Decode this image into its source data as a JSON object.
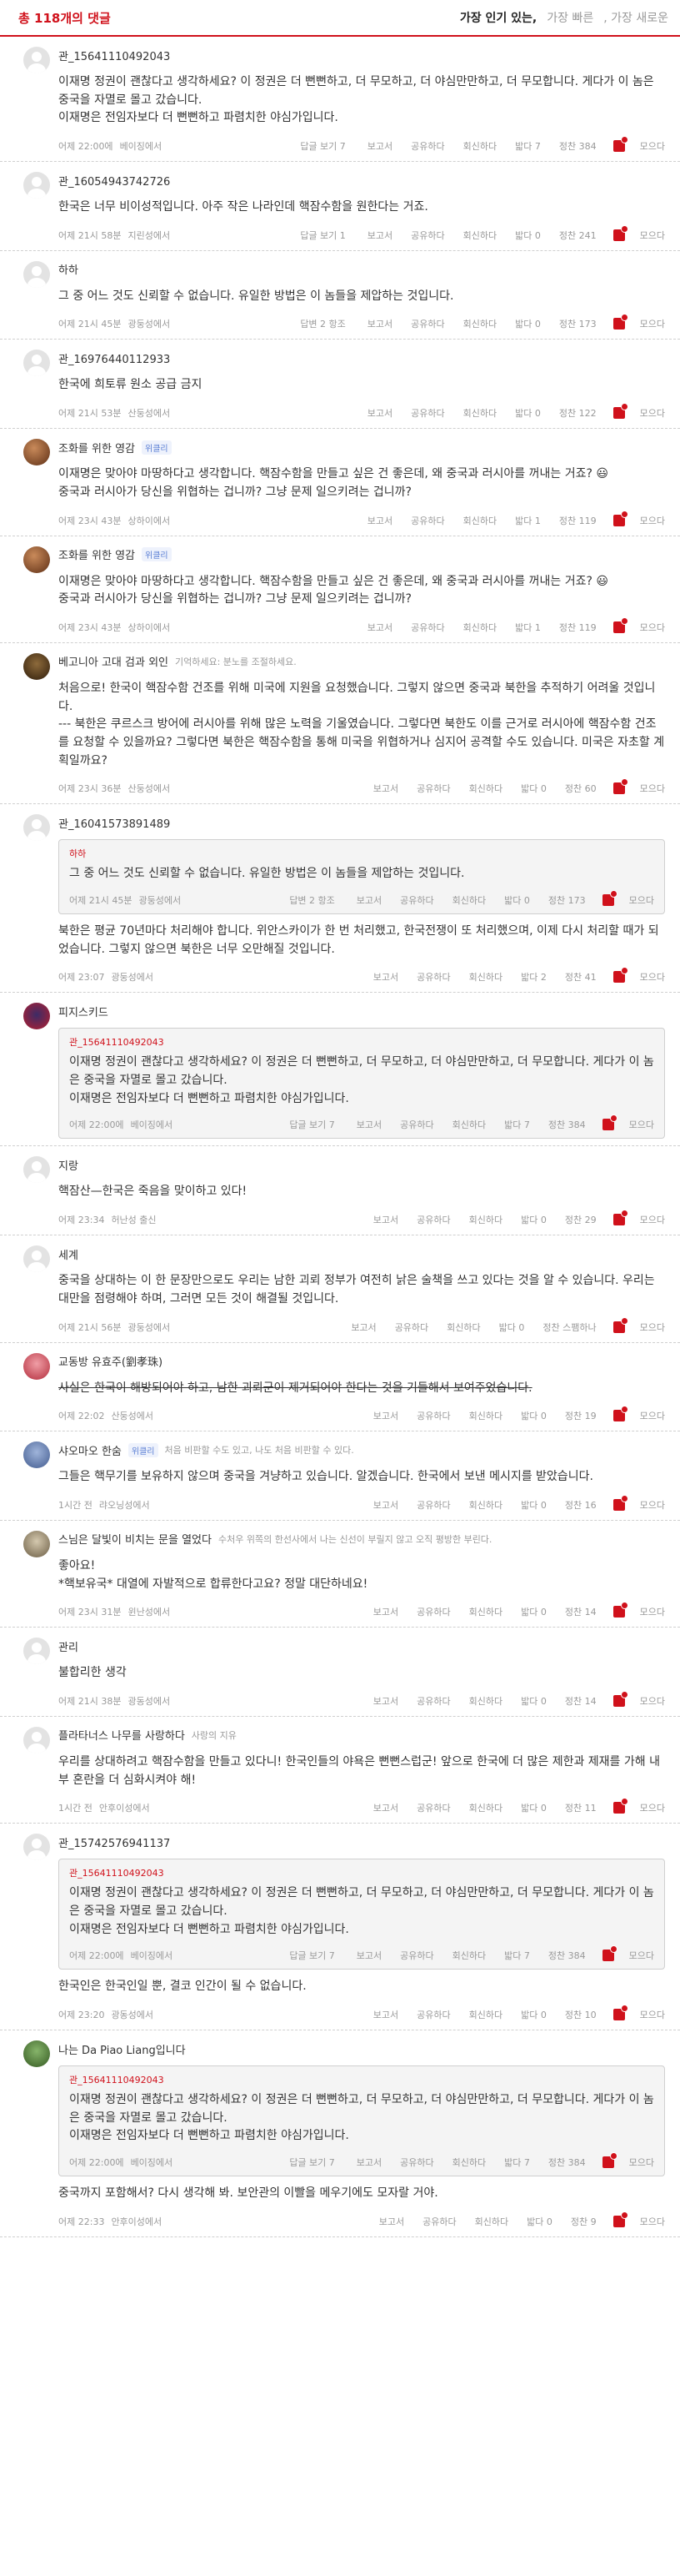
{
  "header": {
    "count_label": "총 118개의 댓글",
    "sort": {
      "popular": "가장 인기 있는,",
      "fast": "가장 빠른",
      "new": ", 가장 새로운"
    }
  },
  "labels": {
    "replies": "답글 보기",
    "report": "보고서",
    "share": "공유하다",
    "recommend": "회신하다",
    "down": "밟다",
    "up": "정찬",
    "more": "모으다"
  },
  "comments": [
    {
      "author": "관_15641110492043",
      "text": "이재명 정권이 괜찮다고 생각하세요? 이 정권은 더 뻔뻔하고, 더 무모하고, 더 야심만만하고, 더 무모합니다. 게다가 이 놈은 중국을 자멸로 몰고 갔습니다.\n이재명은 전임자보다 더 뻔뻔하고 파렴치한 야심가입니다.",
      "time": "어제 22:00에",
      "loc": "베이징에서",
      "replies": "답글 보기 7",
      "down": "밟다 7",
      "up": "정찬 384"
    },
    {
      "author": "관_16054943742726",
      "text": "한국은 너무 비이성적입니다. 아주 작은 나라인데 핵잠수함을 원한다는 거죠.",
      "time": "어제 21시 58분",
      "loc": "지린성에서",
      "replies": "답글 보기 1",
      "down": "밟다 0",
      "up": "정찬 241"
    },
    {
      "author": "하하",
      "text": "그 중 어느 것도 신뢰할 수 없습니다. 유일한 방법은 이 놈들을 제압하는 것입니다.",
      "time": "어제 21시 45분",
      "loc": "광둥성에서",
      "replies": "답변 2 항조",
      "down": "밟다 0",
      "up": "정찬 173"
    },
    {
      "author": "관_16976440112933",
      "text": "한국에 희토류 원소 공급 금지",
      "time": "어제 21시 53분",
      "loc": "산둥성에서",
      "replies": "",
      "down": "밟다 0",
      "up": "정찬 122"
    },
    {
      "author": "조화를 위한 영감",
      "badge": "위클리",
      "text": "이재명은 맞아야 마땅하다고 생각합니다. 핵잠수함을 만들고 싶은 건 좋은데, 왜 중국과 러시아를 꺼내는 거죠? 😃\n중국과 러시아가 당신을 위협하는 겁니까? 그냥 문제 일으키려는 겁니까?",
      "time": "어제 23시 43분",
      "loc": "상하이에서",
      "replies": "",
      "down": "밟다 1",
      "up": "정찬 119"
    },
    {
      "author": "조화를 위한 영감",
      "badge": "위클리",
      "text": "이재명은 맞아야 마땅하다고 생각합니다. 핵잠수함을 만들고 싶은 건 좋은데, 왜 중국과 러시아를 꺼내는 거죠? 😃\n중국과 러시아가 당신을 위협하는 겁니까? 그냥 문제 일으키려는 겁니까?",
      "time": "어제 23시 43분",
      "loc": "상하이에서",
      "replies": "",
      "down": "밟다 1",
      "up": "정찬 119"
    },
    {
      "author": "베고니아 고대 검과 외인",
      "sub": "기억하세요: 분노를 조절하세요.",
      "text": "처음으로! 한국이 핵잠수함 건조를 위해 미국에 지원을 요청했습니다. 그렇지 않으면 중국과 북한을 추적하기 어려울 것입니다.\n--- 북한은 쿠르스크 방어에 러시아를 위해 많은 노력을 기울였습니다. 그렇다면 북한도 이를 근거로 러시아에 핵잠수함 건조를 요청할 수 있을까요? 그렇다면 북한은 핵잠수함을 통해 미국을 위협하거나 심지어 공격할 수도 있습니다. 미국은 자초할 계획일까요?",
      "time": "어제 23시 36분",
      "loc": "산둥성에서",
      "replies": "",
      "down": "밟다 0",
      "up": "정찬 60"
    },
    {
      "author": "관_16041573891489",
      "quote": {
        "author": "하하",
        "text": "그 중 어느 것도 신뢰할 수 없습니다. 유일한 방법은 이 놈들을 제압하는 것입니다.",
        "time": "어제 21시 45분",
        "loc": "광둥성에서",
        "replies": "답변 2 항조",
        "down": "밟다 0",
        "up": "정찬 173"
      },
      "text": "북한은 평균 70년마다 처리해야 합니다. 위안스카이가 한 번 처리했고, 한국전쟁이 또 처리했으며, 이제 다시 처리할 때가 되었습니다. 그렇지 않으면 북한은 너무 오만해질 것입니다.",
      "time": "어제 23:07",
      "loc": "광둥성에서",
      "replies": "",
      "down": "밟다 2",
      "up": "정찬 41"
    },
    {
      "author": "피지스키드",
      "quote": {
        "author": "관_15641110492043",
        "text": "이재명 정권이 괜찮다고 생각하세요? 이 정권은 더 뻔뻔하고, 더 무모하고, 더 야심만만하고, 더 무모합니다. 게다가 이 놈은 중국을 자멸로 몰고 갔습니다.\n이재명은 전임자보다 더 뻔뻔하고 파렴치한 야심가입니다.",
        "time": "어제 22:00에",
        "loc": "베이징에서",
        "replies": "답글 보기 7",
        "down": "밟다 7",
        "up": "정찬 384"
      },
      "text": "",
      "time": "",
      "loc": "",
      "replies": "",
      "down": "",
      "up": ""
    },
    {
      "author": "지랑",
      "text": "핵잠산—한국은 죽음을 맞이하고 있다!",
      "time": "어제 23:34",
      "loc": "허난성 출신",
      "replies": "",
      "down": "밟다 0",
      "up": "정찬 29"
    },
    {
      "author": "세계",
      "text": "중국을 상대하는 이 한 문장만으로도 우리는 남한 괴뢰 정부가 여전히 낡은 술책을 쓰고 있다는 것을 알 수 있습니다. 우리는 대만을 점령해야 하며, 그러면 모든 것이 해결될 것입니다.",
      "time": "어제 21시 56분",
      "loc": "광둥성에서",
      "replies": "",
      "down": "밟다 0",
      "up": "정찬 스팸하나"
    },
    {
      "author": "교동방 유효주(劉孝珠)",
      "text": "사실은 한국이 해방되어야 하고, 남한 괴뢰군이 제거되어야 한다는 것을 기들해서 보여주었습니다.",
      "strike": true,
      "time": "어제 22:02",
      "loc": "산둥성에서",
      "replies": "",
      "down": "밟다 0",
      "up": "정찬 19"
    },
    {
      "author": "샤오마오 한숨",
      "badge": "위클리",
      "sub": "처음 비판할 수도 있고, 나도 처음 비판할 수 있다.",
      "text": "그들은 핵무기를 보유하지 않으며 중국을 겨냥하고 있습니다. 알겠습니다. 한국에서 보낸 메시지를 받았습니다.",
      "time": "1시간 전",
      "loc": "랴오닝성에서",
      "replies": "",
      "down": "밟다 0",
      "up": "정찬 16"
    },
    {
      "author": "스님은 달빛이 비치는 문을 열었다",
      "sub": "수처우 위쪽의 한선사에서 나는 신선이 부릴지 않고 오직 평방한 부린다.",
      "text": "좋아요!\n*핵보유국* 대열에 자발적으로 합류한다고요? 정말 대단하네요!",
      "time": "어제 23시 31분",
      "loc": "윈난성에서",
      "replies": "",
      "down": "밟다 0",
      "up": "정찬 14"
    },
    {
      "author": "관리",
      "text": "불합리한 생각",
      "time": "어제 21시 38분",
      "loc": "광동성에서",
      "replies": "",
      "down": "밟다 0",
      "up": "정찬 14"
    },
    {
      "author": "플라타너스 나무를 사랑하다",
      "sub": "사랑의 지유",
      "text": "우리를 상대하려고 핵잠수함을 만들고 있다니! 한국인들의 야욕은 뻔뻔스럽군! 앞으로 한국에 더 많은 제한과 제재를 가해 내부 혼란을 더 심화시켜야 해!",
      "time": "1시간 전",
      "loc": "안후이성에서",
      "replies": "",
      "down": "밟다 0",
      "up": "정찬 11"
    },
    {
      "author": "관_15742576941137",
      "quote": {
        "author": "관_15641110492043",
        "text": "이재명 정권이 괜찮다고 생각하세요? 이 정권은 더 뻔뻔하고, 더 무모하고, 더 야심만만하고, 더 무모합니다. 게다가 이 놈은 중국을 자멸로 몰고 갔습니다.\n이재명은 전임자보다 더 뻔뻔하고 파렴치한 야심가입니다.",
        "time": "어제 22:00에",
        "loc": "베이징에서",
        "replies": "답글 보기 7",
        "down": "밟다 7",
        "up": "정찬 384"
      },
      "text": "한국인은 한국인일 뿐, 결코 인간이 될 수 없습니다.",
      "time": "어제 23:20",
      "loc": "광동성에서",
      "replies": "",
      "down": "밟다 0",
      "up": "정찬 10"
    },
    {
      "author": "나는 Da Piao Liang입니다",
      "quote": {
        "author": "관_15641110492043",
        "text": "이재명 정권이 괜찮다고 생각하세요? 이 정권은 더 뻔뻔하고, 더 무모하고, 더 야심만만하고, 더 무모합니다. 게다가 이 놈은 중국을 자멸로 몰고 갔습니다.\n이재명은 전임자보다 더 뻔뻔하고 파렴치한 야심가입니다.",
        "time": "어제 22:00에",
        "loc": "베이징에서",
        "replies": "답글 보기 7",
        "down": "밟다 7",
        "up": "정찬 384"
      },
      "text": "중국까지 포함해서? 다시 생각해 봐. 보안관의 이빨을 메우기에도 모자랄 거야.",
      "time": "어제 22:33",
      "loc": "안후이성에서",
      "replies": "",
      "down": "밟다 0",
      "up": "정찬 9"
    }
  ]
}
